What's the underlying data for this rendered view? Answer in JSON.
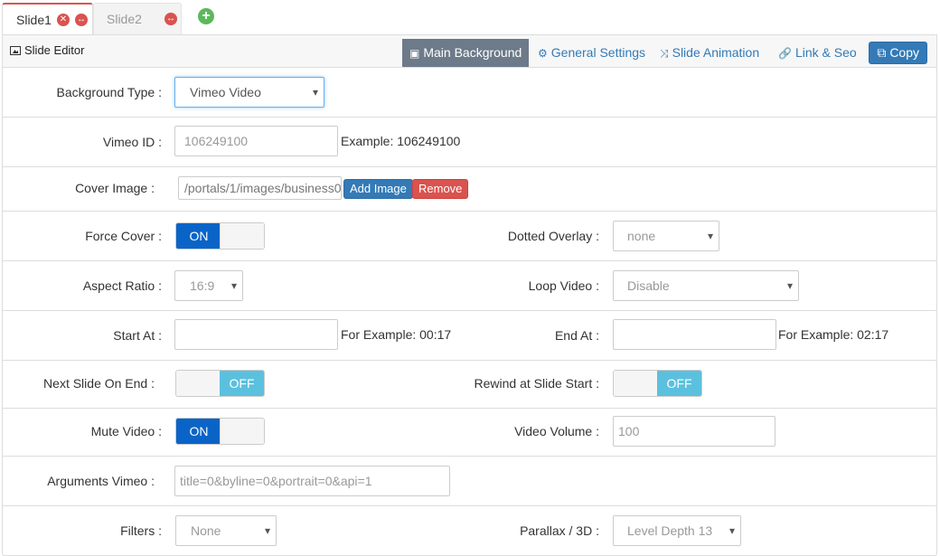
{
  "tabs": [
    {
      "label": "Slide1"
    },
    {
      "label": "Slide2"
    }
  ],
  "header": {
    "title": "Slide Editor",
    "buttons": {
      "main_background": "Main Background",
      "general_settings": "General Settings",
      "slide_animation": "Slide Animation",
      "link_seo": "Link & Seo",
      "copy": "Copy"
    }
  },
  "form": {
    "background_type": {
      "label": "Background Type :",
      "value": "Vimeo Video"
    },
    "vimeo_id": {
      "label": "Vimeo ID :",
      "placeholder": "106249100",
      "hint": "Example: 106249100"
    },
    "cover_image": {
      "label": "Cover Image :",
      "value": "/portals/1/images/business0",
      "add": "Add Image",
      "remove": "Remove"
    },
    "force_cover": {
      "label": "Force Cover :",
      "state": "ON"
    },
    "dotted_overlay": {
      "label": "Dotted Overlay :",
      "value": "none"
    },
    "aspect_ratio": {
      "label": "Aspect Ratio :",
      "value": "16:9"
    },
    "loop_video": {
      "label": "Loop Video :",
      "value": "Disable"
    },
    "start_at": {
      "label": "Start At :",
      "value": "",
      "hint": "For Example: 00:17"
    },
    "end_at": {
      "label": "End At :",
      "value": "",
      "hint": "For Example: 02:17"
    },
    "next_slide_on_end": {
      "label": "Next Slide On End :",
      "state": "OFF"
    },
    "rewind_at_slide_start": {
      "label": "Rewind at Slide Start :",
      "state": "OFF"
    },
    "mute_video": {
      "label": "Mute Video :",
      "state": "ON"
    },
    "video_volume": {
      "label": "Video Volume :",
      "placeholder": "100"
    },
    "arguments_vimeo": {
      "label": "Arguments Vimeo :",
      "value": "title=0&byline=0&portrait=0&api=1"
    },
    "filters": {
      "label": "Filters :",
      "value": "None"
    },
    "parallax": {
      "label": "Parallax / 3D :",
      "value": "Level Depth 13"
    }
  },
  "colors": {
    "accent_blue": "#337ab7",
    "toggle_on": "#0a64c8",
    "toggle_off": "#5bc0de",
    "danger": "#d9534f",
    "success": "#5cb85c"
  }
}
